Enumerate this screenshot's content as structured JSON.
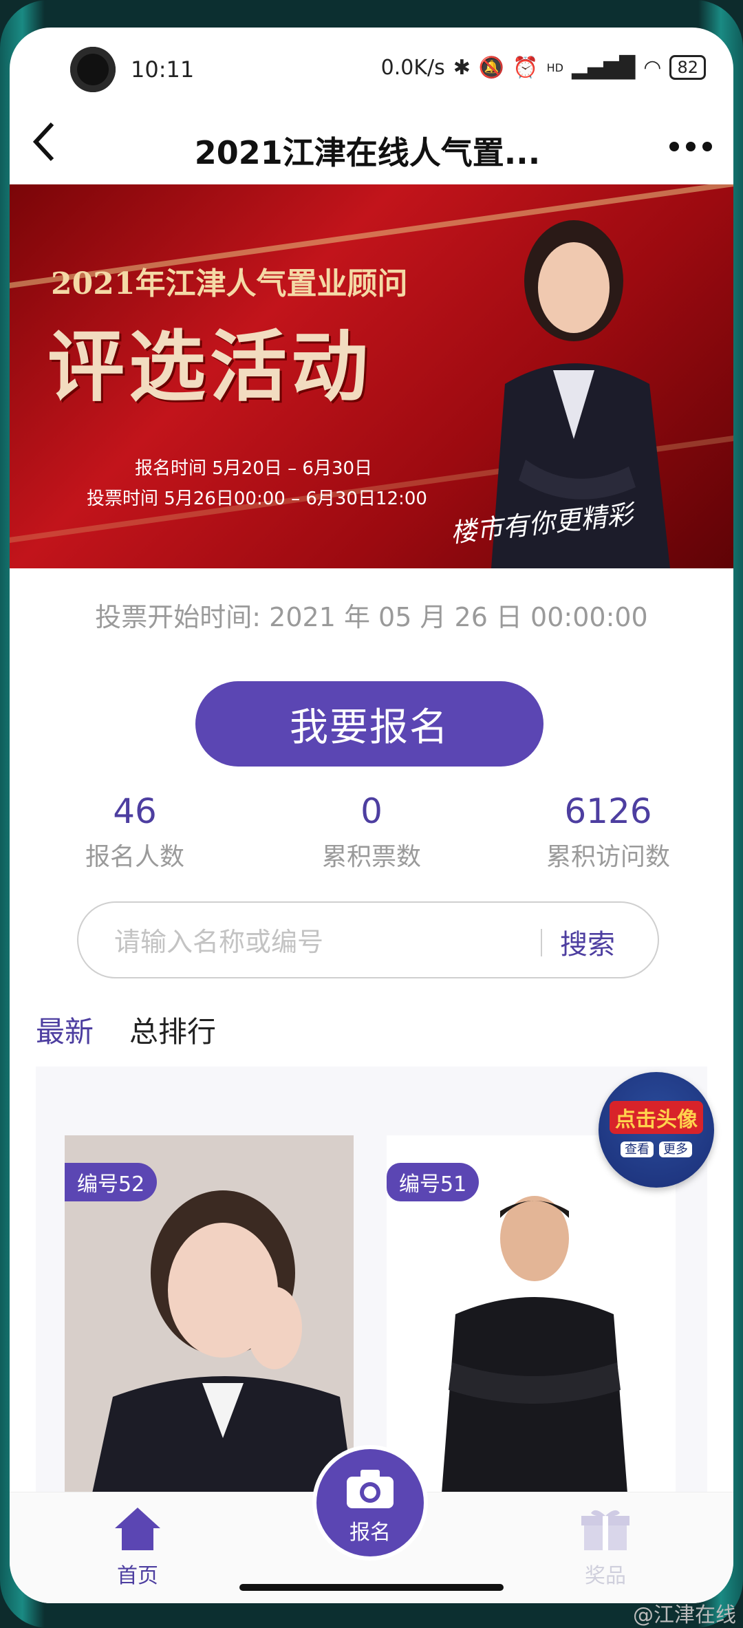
{
  "status_bar": {
    "time": "10:11",
    "network_speed": "0.0K/s",
    "signal": "HD",
    "battery": "82"
  },
  "nav": {
    "title": "2021江津在线人气置...",
    "back_icon": "chevron-left-icon",
    "more_icon": "more-dots-icon"
  },
  "banner": {
    "heading": "2021年江津人气置业顾问",
    "big_title": "评选活动",
    "signup_period": "报名时间  5月20日 – 6月30日",
    "vote_period": "投票时间  5月26日00:00 – 6月30日12:00",
    "slogan": "楼市有你更精彩"
  },
  "vote_start": "投票开始时间: 2021 年 05 月 26 日  00:00:00",
  "signup_button": "我要报名",
  "stats": [
    {
      "value": "46",
      "label": "报名人数"
    },
    {
      "value": "0",
      "label": "累积票数"
    },
    {
      "value": "6126",
      "label": "累积访问数"
    }
  ],
  "search": {
    "placeholder": "请输入名称或编号",
    "button": "搜索"
  },
  "tabs": [
    {
      "label": "最新",
      "active": true
    },
    {
      "label": "总排行",
      "active": false
    }
  ],
  "cards": [
    {
      "badge": "编号52"
    },
    {
      "badge": "编号51"
    }
  ],
  "floating_badge": {
    "title": "点击头像",
    "left": "查看",
    "right": "更多"
  },
  "bottom_bar": {
    "home": "首页",
    "signup": "报名",
    "prize": "奖品"
  },
  "watermark": "@江津在线",
  "colors": {
    "accent": "#5b46b3",
    "banner_red": "#c2141b",
    "gold": "#f4d9a6"
  }
}
